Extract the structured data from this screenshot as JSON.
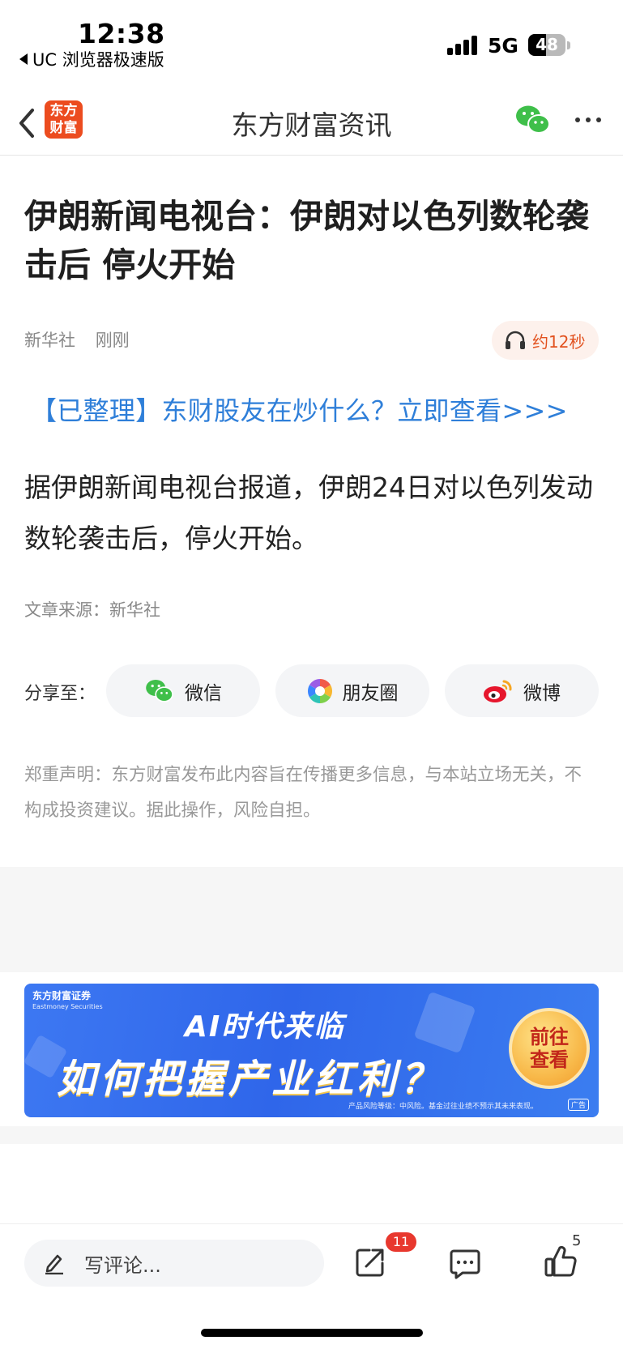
{
  "status_bar": {
    "time": "12:38",
    "back_app": "UC 浏览器极速版",
    "network": "5G",
    "battery": "48",
    "battery_level": 0.48
  },
  "nav": {
    "logo_text_line1": "东方",
    "logo_text_line2": "财富",
    "title": "东方财富资讯"
  },
  "article": {
    "title": "伊朗新闻电视台：伊朗对以色列数轮袭击后 停火开始",
    "source_name": "新华社",
    "time": "刚刚",
    "audio_duration": "约12秒",
    "promo_link": "【已整理】东财股友在炒什么？立即查看>>>",
    "body": "据伊朗新闻电视台报道，伊朗24日对以色列发动数轮袭击后，停火开始。",
    "source_line": "文章来源：新华社"
  },
  "share": {
    "label": "分享至：",
    "buttons": [
      {
        "label": "微信",
        "icon": "wechat-icon"
      },
      {
        "label": "朋友圈",
        "icon": "moments-icon"
      },
      {
        "label": "微博",
        "icon": "weibo-icon"
      }
    ]
  },
  "disclaimer": {
    "heading": "郑重声明：",
    "text": "东方财富发布此内容旨在传播更多信息，与本站立场无关，不构成投资建议。据此操作，风险自担。"
  },
  "ad": {
    "brand": "东方财富证券",
    "brand_en": "Eastmoney Securities",
    "line1": "AI时代来临",
    "line2": "如何把握产业红利？",
    "cta_line1": "前往",
    "cta_line2": "查看",
    "risk_note": "产品风险等级：中风险。基金过往业绩不预示其未来表现。",
    "tag": "广告"
  },
  "bottom_bar": {
    "comment_placeholder": "写评论...",
    "share_badge": "11",
    "like_count": "5"
  },
  "colors": {
    "brand_orange": "#ec4c1f",
    "link_blue": "#2f7fd9",
    "badge_red": "#e8382e",
    "ad_blue": "#2f66ea"
  }
}
